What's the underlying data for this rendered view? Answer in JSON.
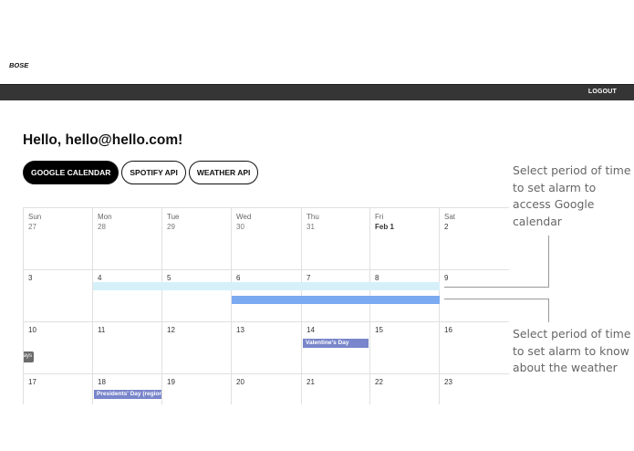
{
  "header": {
    "logo_text": "BOSE",
    "logout_label": "LOGOUT"
  },
  "greeting": "Hello, hello@hello.com!",
  "tabs": [
    {
      "label": "GOOGLE CALENDAR",
      "active": true
    },
    {
      "label": "SPOTIFY API",
      "active": false
    },
    {
      "label": "WEATHER API",
      "active": false
    }
  ],
  "calendar": {
    "weekdays": [
      "Sun",
      "Mon",
      "Tue",
      "Wed",
      "Thu",
      "Fri",
      "Sat"
    ],
    "weeks": [
      [
        "27",
        "28",
        "29",
        "30",
        "31",
        "Feb 1",
        "2"
      ],
      [
        "3",
        "4",
        "5",
        "6",
        "7",
        "8",
        "9"
      ],
      [
        "10",
        "11",
        "12",
        "13",
        "14",
        "15",
        "16"
      ],
      [
        "17",
        "18",
        "19",
        "20",
        "21",
        "22",
        "23"
      ]
    ],
    "events": {
      "valentines": "Valentine's Day",
      "presidents": "Presidents' Day (regional holiday)",
      "more_pill": "Holidays"
    },
    "colors": {
      "selection_light": "#d6f0fa",
      "selection_dark": "#7baaf1",
      "event": "#7986cb"
    }
  },
  "annotations": {
    "top": "Select period of time to set alarm to access Google calendar",
    "bottom": "Select period of time to set alarm to know about the weather"
  }
}
